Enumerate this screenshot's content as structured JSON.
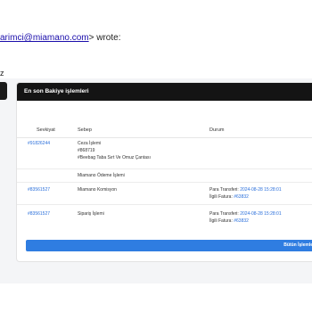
{
  "email": {
    "address_fragment": "arimci@miamano.com",
    "wrote_suffix": "> wrote:",
    "trailing_fragment": "z"
  },
  "card": {
    "title": "En son Bakiye işlemleri",
    "columns": [
      "Sevkiyat",
      "Sebep",
      "Durum"
    ],
    "rows": [
      {
        "shipment": "#91826244",
        "reason_lines": [
          "Ceza İşlemi",
          "#868719",
          "#Beebag Taba Sırt Ve Omuz Çantası"
        ],
        "status_lines": []
      },
      {
        "shipment": "",
        "reason_lines": [
          "Miamano Ödeme İşlemi"
        ],
        "status_lines": []
      },
      {
        "shipment": "#83561527",
        "reason_lines": [
          "Miamano Komisyon"
        ],
        "status_lines": [
          {
            "label": "Para Transferi: ",
            "value": "2024-08-28 15:28:01"
          },
          {
            "label": "İlgili Fatura: ",
            "value": "#63832"
          }
        ]
      },
      {
        "shipment": "#83561527",
        "reason_lines": [
          "Sipariş İşlemi"
        ],
        "status_lines": [
          {
            "label": "Para Transferi: ",
            "value": "2024-08-28 15:28:01"
          },
          {
            "label": "İlgili Fatura: ",
            "value": "#63832"
          }
        ]
      }
    ],
    "button_label": "Bütün İşlemler",
    "colors": {
      "header_bg": "#141414",
      "link": "#2a6fdb",
      "button": "#2f7de1"
    }
  }
}
